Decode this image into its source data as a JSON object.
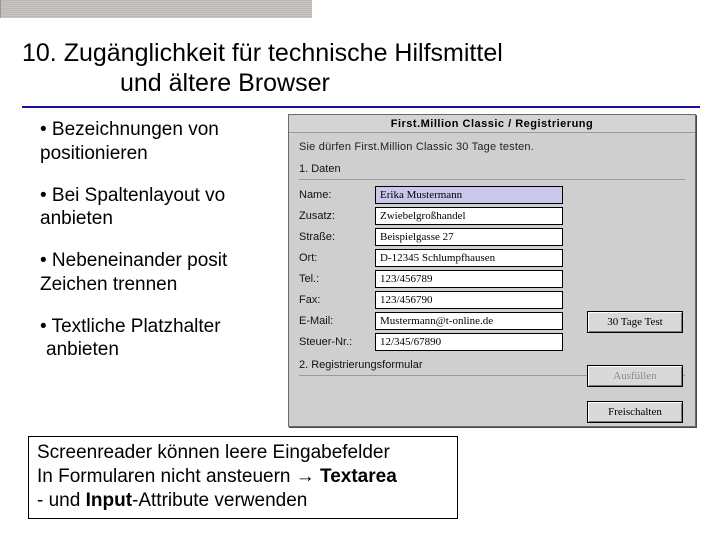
{
  "heading": {
    "line1": "10. Zugänglichkeit für technische Hilfsmittel",
    "line2": "und ältere Browser"
  },
  "bullets": {
    "b1a": "• Bezeichnungen von",
    "b1b": "positionieren",
    "b2a": "• Bei Spaltenlayout vo",
    "b2b": "anbieten",
    "b3a": "• Nebeneinander posit",
    "b3b": "Zeichen trennen",
    "b4a": "• Textliche Platzhalter",
    "b4b": "anbieten"
  },
  "dialog": {
    "title": "First.Million Classic / Registrierung",
    "intro": "Sie dürfen First.Million Classic 30 Tage testen.",
    "group1": "1. Daten",
    "group2": "2. Registrierungsformular",
    "fields": {
      "name": {
        "label": "Name:",
        "value": "Erika Mustermann"
      },
      "zusatz": {
        "label": "Zusatz:",
        "value": "Zwiebelgroßhandel"
      },
      "strasse": {
        "label": "Straße:",
        "value": "Beispielgasse 27"
      },
      "ort": {
        "label": "Ort:",
        "value": "D-12345 Schlumpfhausen"
      },
      "tel": {
        "label": "Tel.:",
        "value": "123/456789"
      },
      "fax": {
        "label": "Fax:",
        "value": "123/456790"
      },
      "email": {
        "label": "E-Mail:",
        "value": "Mustermann@t-online.de"
      },
      "steuer": {
        "label": "Steuer-Nr.:",
        "value": "12/345/67890"
      }
    },
    "buttons": {
      "test": "30 Tage Test",
      "ausfuellen": "Ausfüllen",
      "frei": "Freischalten"
    }
  },
  "footer": {
    "l1a": "Screenreader können leere Eingabefelder",
    "l2a": "In Formularen nicht ansteuern ",
    "l2arrow": "→",
    "l2b": " Textarea",
    "l3a": "- und ",
    "l3b": "Input",
    "l3c": "-Attribute verwenden"
  }
}
